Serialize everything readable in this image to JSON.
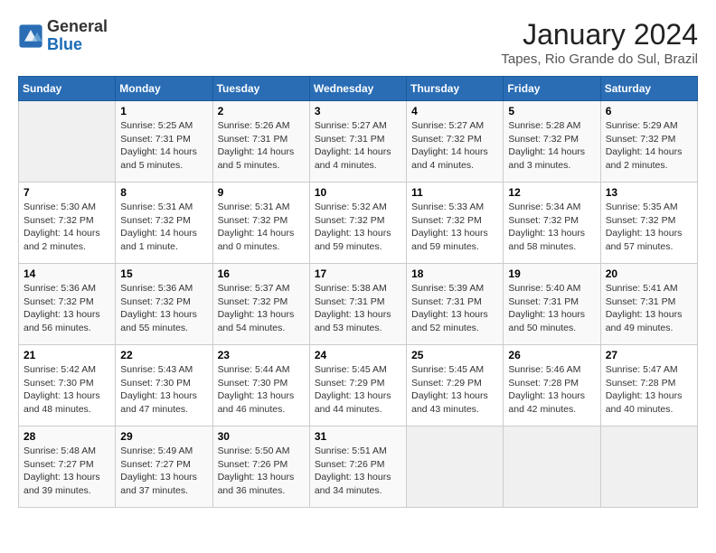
{
  "header": {
    "logo_general": "General",
    "logo_blue": "Blue",
    "month": "January 2024",
    "location": "Tapes, Rio Grande do Sul, Brazil"
  },
  "weekdays": [
    "Sunday",
    "Monday",
    "Tuesday",
    "Wednesday",
    "Thursday",
    "Friday",
    "Saturday"
  ],
  "weeks": [
    [
      {
        "day": "",
        "info": ""
      },
      {
        "day": "1",
        "info": "Sunrise: 5:25 AM\nSunset: 7:31 PM\nDaylight: 14 hours\nand 5 minutes."
      },
      {
        "day": "2",
        "info": "Sunrise: 5:26 AM\nSunset: 7:31 PM\nDaylight: 14 hours\nand 5 minutes."
      },
      {
        "day": "3",
        "info": "Sunrise: 5:27 AM\nSunset: 7:31 PM\nDaylight: 14 hours\nand 4 minutes."
      },
      {
        "day": "4",
        "info": "Sunrise: 5:27 AM\nSunset: 7:32 PM\nDaylight: 14 hours\nand 4 minutes."
      },
      {
        "day": "5",
        "info": "Sunrise: 5:28 AM\nSunset: 7:32 PM\nDaylight: 14 hours\nand 3 minutes."
      },
      {
        "day": "6",
        "info": "Sunrise: 5:29 AM\nSunset: 7:32 PM\nDaylight: 14 hours\nand 2 minutes."
      }
    ],
    [
      {
        "day": "7",
        "info": "Sunrise: 5:30 AM\nSunset: 7:32 PM\nDaylight: 14 hours\nand 2 minutes."
      },
      {
        "day": "8",
        "info": "Sunrise: 5:31 AM\nSunset: 7:32 PM\nDaylight: 14 hours\nand 1 minute."
      },
      {
        "day": "9",
        "info": "Sunrise: 5:31 AM\nSunset: 7:32 PM\nDaylight: 14 hours\nand 0 minutes."
      },
      {
        "day": "10",
        "info": "Sunrise: 5:32 AM\nSunset: 7:32 PM\nDaylight: 13 hours\nand 59 minutes."
      },
      {
        "day": "11",
        "info": "Sunrise: 5:33 AM\nSunset: 7:32 PM\nDaylight: 13 hours\nand 59 minutes."
      },
      {
        "day": "12",
        "info": "Sunrise: 5:34 AM\nSunset: 7:32 PM\nDaylight: 13 hours\nand 58 minutes."
      },
      {
        "day": "13",
        "info": "Sunrise: 5:35 AM\nSunset: 7:32 PM\nDaylight: 13 hours\nand 57 minutes."
      }
    ],
    [
      {
        "day": "14",
        "info": "Sunrise: 5:36 AM\nSunset: 7:32 PM\nDaylight: 13 hours\nand 56 minutes."
      },
      {
        "day": "15",
        "info": "Sunrise: 5:36 AM\nSunset: 7:32 PM\nDaylight: 13 hours\nand 55 minutes."
      },
      {
        "day": "16",
        "info": "Sunrise: 5:37 AM\nSunset: 7:32 PM\nDaylight: 13 hours\nand 54 minutes."
      },
      {
        "day": "17",
        "info": "Sunrise: 5:38 AM\nSunset: 7:31 PM\nDaylight: 13 hours\nand 53 minutes."
      },
      {
        "day": "18",
        "info": "Sunrise: 5:39 AM\nSunset: 7:31 PM\nDaylight: 13 hours\nand 52 minutes."
      },
      {
        "day": "19",
        "info": "Sunrise: 5:40 AM\nSunset: 7:31 PM\nDaylight: 13 hours\nand 50 minutes."
      },
      {
        "day": "20",
        "info": "Sunrise: 5:41 AM\nSunset: 7:31 PM\nDaylight: 13 hours\nand 49 minutes."
      }
    ],
    [
      {
        "day": "21",
        "info": "Sunrise: 5:42 AM\nSunset: 7:30 PM\nDaylight: 13 hours\nand 48 minutes."
      },
      {
        "day": "22",
        "info": "Sunrise: 5:43 AM\nSunset: 7:30 PM\nDaylight: 13 hours\nand 47 minutes."
      },
      {
        "day": "23",
        "info": "Sunrise: 5:44 AM\nSunset: 7:30 PM\nDaylight: 13 hours\nand 46 minutes."
      },
      {
        "day": "24",
        "info": "Sunrise: 5:45 AM\nSunset: 7:29 PM\nDaylight: 13 hours\nand 44 minutes."
      },
      {
        "day": "25",
        "info": "Sunrise: 5:45 AM\nSunset: 7:29 PM\nDaylight: 13 hours\nand 43 minutes."
      },
      {
        "day": "26",
        "info": "Sunrise: 5:46 AM\nSunset: 7:28 PM\nDaylight: 13 hours\nand 42 minutes."
      },
      {
        "day": "27",
        "info": "Sunrise: 5:47 AM\nSunset: 7:28 PM\nDaylight: 13 hours\nand 40 minutes."
      }
    ],
    [
      {
        "day": "28",
        "info": "Sunrise: 5:48 AM\nSunset: 7:27 PM\nDaylight: 13 hours\nand 39 minutes."
      },
      {
        "day": "29",
        "info": "Sunrise: 5:49 AM\nSunset: 7:27 PM\nDaylight: 13 hours\nand 37 minutes."
      },
      {
        "day": "30",
        "info": "Sunrise: 5:50 AM\nSunset: 7:26 PM\nDaylight: 13 hours\nand 36 minutes."
      },
      {
        "day": "31",
        "info": "Sunrise: 5:51 AM\nSunset: 7:26 PM\nDaylight: 13 hours\nand 34 minutes."
      },
      {
        "day": "",
        "info": ""
      },
      {
        "day": "",
        "info": ""
      },
      {
        "day": "",
        "info": ""
      }
    ]
  ]
}
